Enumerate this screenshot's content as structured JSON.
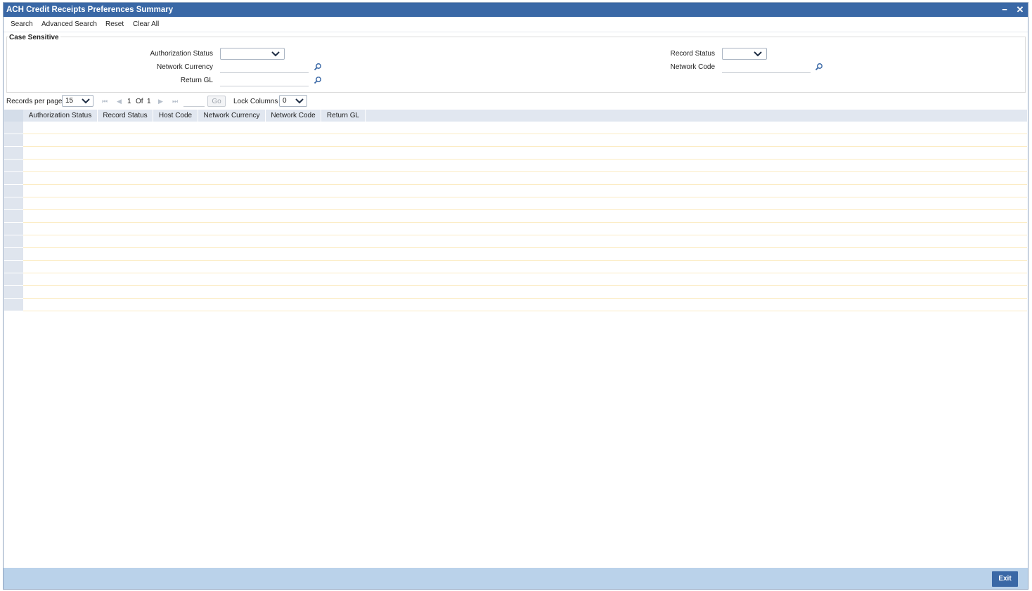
{
  "window": {
    "title": "ACH Credit Receipts Preferences Summary",
    "minimize_glyph": "−",
    "close_glyph": "✕"
  },
  "menu": {
    "search": "Search",
    "advanced_search": "Advanced Search",
    "reset": "Reset",
    "clear_all": "Clear All"
  },
  "criteria": {
    "legend": "Case Sensitive",
    "authorization_status_label": "Authorization Status",
    "authorization_status_value": "",
    "network_currency_label": "Network Currency",
    "network_currency_value": "",
    "return_gl_label": "Return GL",
    "return_gl_value": "",
    "record_status_label": "Record Status",
    "record_status_value": "",
    "network_code_label": "Network Code",
    "network_code_value": ""
  },
  "pager": {
    "records_per_page_label": "Records per page",
    "records_per_page_value": "15",
    "current_page": "1",
    "of_label": "Of",
    "total_pages": "1",
    "goto_value": "",
    "go_label": "Go",
    "lock_columns_label": "Lock Columns",
    "lock_columns_value": "0"
  },
  "grid": {
    "columns": [
      "Authorization Status",
      "Record Status",
      "Host Code",
      "Network Currency",
      "Network Code",
      "Return GL"
    ],
    "row_count": 15
  },
  "footer": {
    "exit_label": "Exit"
  },
  "colors": {
    "titlebar": "#3a68a6",
    "footer": "#bad2ea",
    "grid_header": "#e1e7f0",
    "row_line": "#fcecc4"
  },
  "icons": {
    "lookup": "magnifier-icon",
    "dropdown": "chevron-down-icon",
    "first": "first-page-icon",
    "prev": "prev-page-icon",
    "next": "next-page-icon",
    "last": "last-page-icon"
  }
}
